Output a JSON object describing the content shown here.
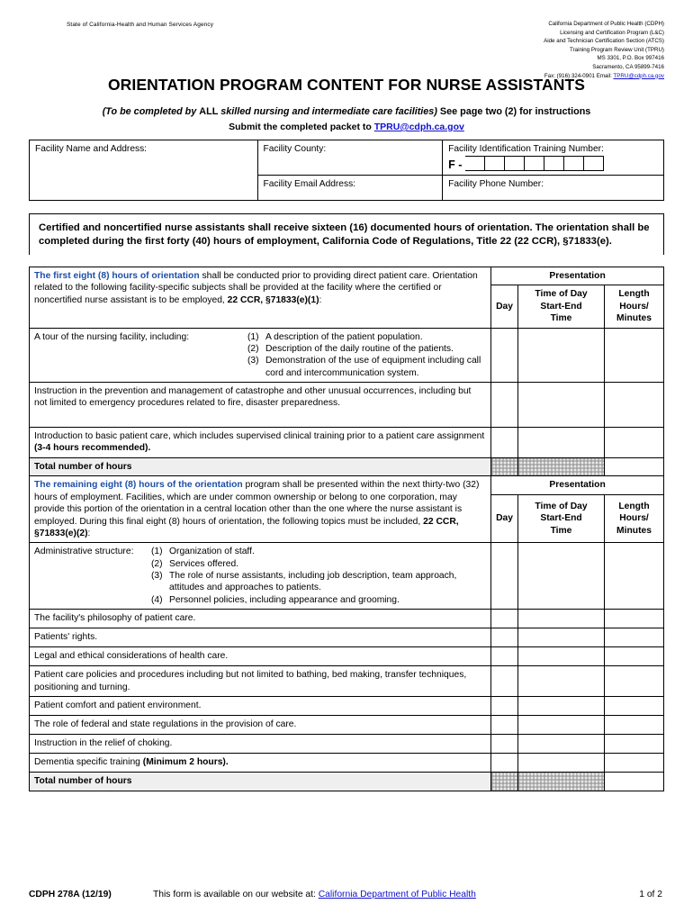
{
  "header": {
    "agency": "State of California-Health and Human Services Agency",
    "dept_lines": [
      "California Department of Public Health (CDPH)",
      "Licensing and Certification Program (L&C)",
      "Aide and Technician Certification Section (ATCS)",
      "Training Program Review Unit (TPRU)",
      "MS 3301, P.O. Box 997416",
      "Sacramento, CA 95899-7416"
    ],
    "fax_prefix": "Fax: (916) 324-0901 Email:",
    "fax_email": "TPRU@cdph.ca.gov"
  },
  "title": "ORIENTATION PROGRAM CONTENT FOR NURSE ASSISTANTS",
  "subtitle": {
    "pre": "(To be completed by ",
    "all": "ALL",
    "mid": " skilled nursing and intermediate care facilities)",
    "post": "  See page two (2) for instructions"
  },
  "submit": {
    "text": "Submit the completed packet to ",
    "email": "TPRU@cdph.ca.gov"
  },
  "facility": {
    "name_address": "Facility Name and Address:",
    "county": "Facility County:",
    "email": "Facility Email Address:",
    "phone": "Facility Phone Number:",
    "id_label": "Facility Identification Training Number:",
    "id_prefix": "F -",
    "id_box_count": 7
  },
  "statute": "Certified and noncertified nurse assistants shall receive sixteen (16) documented hours of orientation. The orientation shall be completed during the first forty (40) hours of employment, California Code of Regulations, Title 22 (22 CCR), §71833(e).",
  "columns": {
    "presentation": "Presentation",
    "day": "Day",
    "time_of_day": "Time of Day",
    "start_end": "Start-End",
    "time": "Time",
    "length": "Length",
    "hours": "Hours/",
    "minutes": "Minutes"
  },
  "section1": {
    "intro_blue": "The first eight (8) hours of orientation",
    "intro_rest": " shall be conducted prior to providing direct patient care. Orientation related to the following facility-specific subjects shall be provided at the facility where the certified or noncertified nurse assistant is to be employed, ",
    "intro_bold": "22 CCR, §71833(e)(1)",
    "intro_tail": ":",
    "rows": [
      {
        "lead": "A tour of the nursing facility, including:",
        "items": [
          {
            "n": "(1)",
            "text": "A description of the patient population."
          },
          {
            "n": "(2)",
            "text": "Description of the daily routine of the patients."
          },
          {
            "n": "(3)",
            "text": "Demonstration of the use of equipment including call cord and intercommunication system."
          }
        ]
      },
      {
        "lead": "Instruction in the prevention and management of catastrophe and other unusual occurrences, including but not limited to emergency procedures related to fire, disaster preparedness.",
        "items": []
      },
      {
        "lead": "Introduction to basic patient care, which includes supervised clinical training prior to a patient care assignment ",
        "bold_tail": "(3-4 hours recommended).",
        "items": []
      }
    ],
    "total_label": "Total number of hours"
  },
  "section2": {
    "intro_blue": "The remaining eight (8) hours of the orientation",
    "intro_rest": " program shall be presented within the next thirty-two (32) hours of employment. Facilities, which are under common ownership or belong to one corporation, may provide this portion of the orientation in a central location other than the one where the nurse assistant is employed. During this final eight (8) hours of orientation, the following topics must be included, ",
    "intro_bold": "22 CCR, §71833(e)(2)",
    "intro_tail": ":",
    "admin": {
      "lead": "Administrative structure:",
      "items": [
        {
          "n": "(1)",
          "text": "Organization of staff."
        },
        {
          "n": "(2)",
          "text": "Services offered."
        },
        {
          "n": "(3)",
          "text": "The role of nurse assistants, including job description, team approach, attitudes and approaches to patients."
        },
        {
          "n": "(4)",
          "text": "Personnel policies, including appearance and grooming."
        }
      ]
    },
    "topics": [
      "The facility's philosophy of patient care.",
      "Patients' rights.",
      "Legal and ethical considerations of health care.",
      "Patient care policies and procedures including but not limited to bathing, bed making, transfer techniques, positioning and turning.",
      "Patient comfort and patient environment.",
      "The role of federal and state regulations in the provision of care.",
      "Instruction in the relief of choking."
    ],
    "dementia_lead": "Dementia specific training ",
    "dementia_bold": "(Minimum 2 hours).",
    "total_label": "Total number of hours"
  },
  "footer": {
    "form_id": "CDPH 278A (12/19)",
    "website_text": "This form is available on our website at: ",
    "website_link": "California Department of Public Health",
    "page": "1 of 2"
  }
}
